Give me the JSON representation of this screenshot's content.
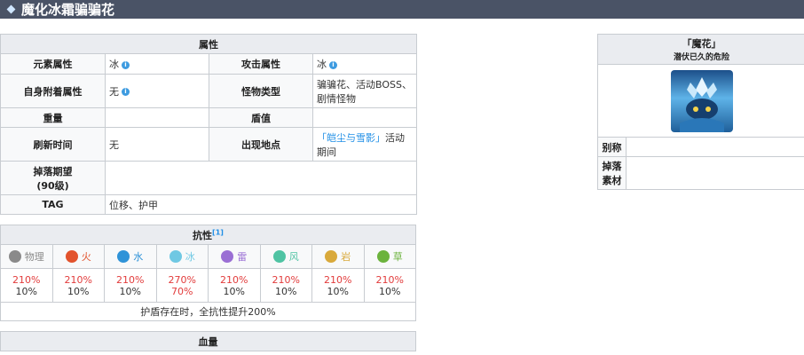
{
  "header": {
    "title": "魔化冰霜骗骗花"
  },
  "attributes": {
    "section_title": "属性",
    "rows": [
      {
        "l1": "元素属性",
        "v1": "冰",
        "l2": "攻击属性",
        "v2": "冰"
      },
      {
        "l1": "自身附着属性",
        "v1": "无",
        "l2": "怪物类型",
        "v2": "骗骗花、活动BOSS、剧情怪物"
      },
      {
        "l1": "重量",
        "v1": "",
        "l2": "盾值",
        "v2": ""
      },
      {
        "l1": "刷新时间",
        "v1": "无",
        "l2": "出现地点",
        "v2_link": "「皑尘与雪影」",
        "v2": "活动期间"
      }
    ],
    "drop_label": "掉落期望\n(90级)",
    "drop_value": "",
    "tag_label": "TAG",
    "tag_value": "位移、护甲"
  },
  "resistance": {
    "title": "抗性",
    "footnote": "[1]",
    "elements": [
      {
        "name": "物理",
        "icon": "physical-icon",
        "color": "#8a8a8a",
        "v1": "210%",
        "v2": "10%"
      },
      {
        "name": "火",
        "icon": "pyro-icon",
        "color": "#e2532d",
        "v1": "210%",
        "v2": "10%"
      },
      {
        "name": "水",
        "icon": "hydro-icon",
        "color": "#2f93d8",
        "v1": "210%",
        "v2": "10%"
      },
      {
        "name": "冰",
        "icon": "cryo-icon",
        "color": "#6fc8e3",
        "v1": "270%",
        "v2": "70%"
      },
      {
        "name": "雷",
        "icon": "electro-icon",
        "color": "#9a6fd4",
        "v1": "210%",
        "v2": "10%"
      },
      {
        "name": "风",
        "icon": "anemo-icon",
        "color": "#4fc3a3",
        "v1": "210%",
        "v2": "10%"
      },
      {
        "name": "岩",
        "icon": "geo-icon",
        "color": "#d9a93b",
        "v1": "210%",
        "v2": "10%"
      },
      {
        "name": "草",
        "icon": "dendro-icon",
        "color": "#6cb33d",
        "v1": "210%",
        "v2": "10%"
      }
    ],
    "note": "护盾存在时，全抗性提升200%"
  },
  "hp": {
    "title": "血量"
  },
  "sidebar": {
    "name": "「魔花」",
    "subtitle": "潜伏已久的危险",
    "alias_label": "别称",
    "alias_value": "",
    "drop_label": "掉落\n素材",
    "drop_value": ""
  }
}
